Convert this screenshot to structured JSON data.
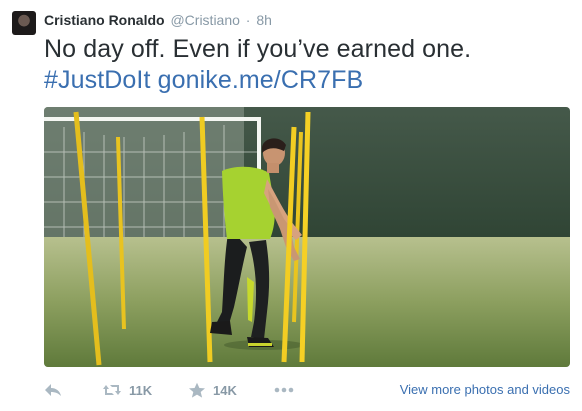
{
  "author": {
    "name": "Cristiano Ronaldo",
    "handle": "@Cristiano",
    "separator": "·",
    "time": "8h"
  },
  "tweet": {
    "text": "No day off. Even if you’ve earned one.",
    "hashtag": "#JustDoIt",
    "link": "gonike.me/CR7FB"
  },
  "actions": {
    "retweet_count": "11K",
    "favorite_count": "14K",
    "view_more": "View more photos and videos"
  },
  "icons": {
    "reply": "reply-icon",
    "retweet": "retweet-icon",
    "favorite": "star-icon",
    "more": "more-icon"
  },
  "colors": {
    "link": "#3a6fb0",
    "muted": "#8899a6",
    "text": "#292f33"
  }
}
